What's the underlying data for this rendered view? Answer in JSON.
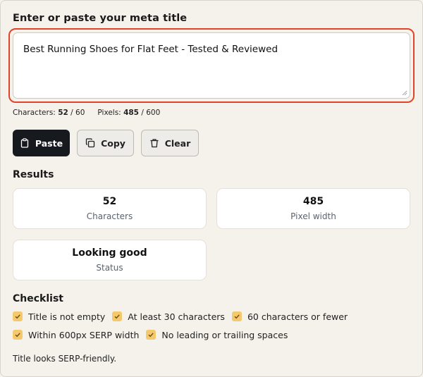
{
  "input": {
    "label": "Enter or paste your meta title",
    "value": "Best Running Shoes for Flat Feet - Tested & Reviewed"
  },
  "counts": {
    "characters_label": "Characters:",
    "characters_value": "52",
    "characters_max": "/ 60",
    "pixels_label": "Pixels:",
    "pixels_value": "485",
    "pixels_max": "/ 600"
  },
  "buttons": {
    "paste": "Paste",
    "copy": "Copy",
    "clear": "Clear"
  },
  "results": {
    "title": "Results",
    "cards": [
      {
        "value": "52",
        "label": "Characters"
      },
      {
        "value": "485",
        "label": "Pixel width"
      },
      {
        "value": "Looking good",
        "label": "Status"
      }
    ]
  },
  "checklist": {
    "title": "Checklist",
    "items": [
      {
        "label": "Title is not empty",
        "checked": true
      },
      {
        "label": "At least 30 characters",
        "checked": true
      },
      {
        "label": "60 characters or fewer",
        "checked": true
      },
      {
        "label": "Within 600px SERP width",
        "checked": true
      },
      {
        "label": "No leading or trailing spaces",
        "checked": true
      }
    ]
  },
  "footer": {
    "note": "Title looks SERP-friendly."
  },
  "colors": {
    "accent_ring": "#e0442b",
    "checkbox": "#f4c96b",
    "primary_button": "#16191e",
    "background": "#f5f2ec"
  }
}
